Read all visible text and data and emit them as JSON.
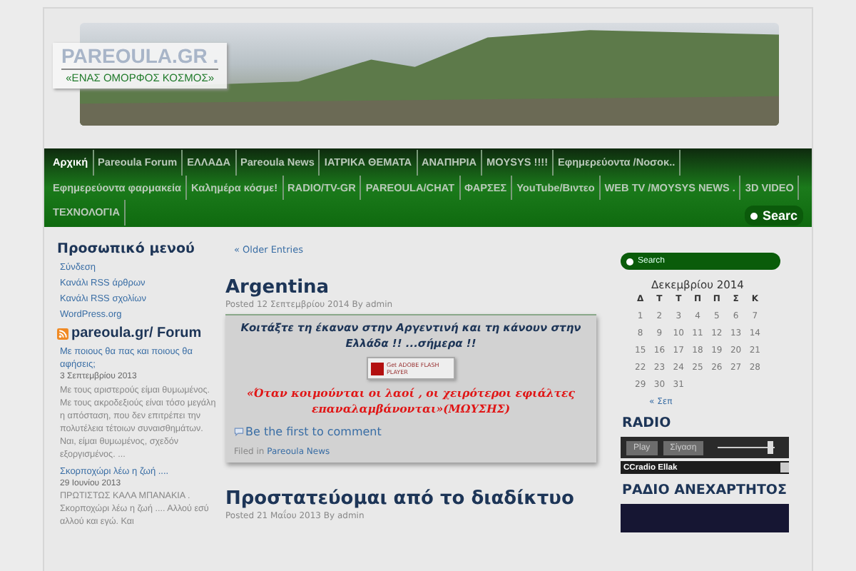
{
  "header": {
    "site_title": "PAREOULA.GR .",
    "tagline": "«ΕΝΑΣ ΟΜΟΡΦΟΣ ΚΟΣΜΟΣ»"
  },
  "nav": {
    "items": [
      {
        "label": "Αρχική",
        "selected": true
      },
      {
        "label": "Pareoula Forum",
        "selected": false
      },
      {
        "label": "ΕΛΛΑΔΑ",
        "selected": false
      },
      {
        "label": "Pareoula News",
        "selected": false
      },
      {
        "label": "ΙΑΤΡΙΚΑ ΘΕΜΑΤΑ",
        "selected": false
      },
      {
        "label": "ΑΝΑΠΗΡΙΑ",
        "selected": false
      },
      {
        "label": "MOYSYS !!!!",
        "selected": false
      },
      {
        "label": "Εφημερεύοντα /Νοσοκ..",
        "selected": false
      },
      {
        "label": "Εφημερεύοντα φαρμακεία",
        "selected": false
      },
      {
        "label": "Καλημέρα κόσμε!",
        "selected": false
      },
      {
        "label": "RADIO/TV-GR",
        "selected": false
      },
      {
        "label": "PAREOULA/CHAT",
        "selected": false
      },
      {
        "label": "ΦΑΡΣΕΣ",
        "selected": false
      },
      {
        "label": "YouTube/Βιντεο",
        "selected": false
      },
      {
        "label": "WEB TV /MOYSYS NEWS .",
        "selected": false
      },
      {
        "label": "3D VIDEO",
        "selected": false
      },
      {
        "label": "ΤΕΧΝΟΛΟΓΙΑ",
        "selected": false
      }
    ],
    "search_button": "Searc"
  },
  "left_sidebar": {
    "menu_title": "Προσωπικό μενού",
    "menu_links": [
      "Σύνδεση",
      "Κανάλι RSS άρθρων",
      "Κανάλι RSS σχολίων",
      "WordPress.org"
    ],
    "forum_title": "pareoula.gr/ Forum",
    "forum_posts": [
      {
        "title": "Με ποιους θα πας και ποιους θα αφήσεις;",
        "date": "3 Σεπτεμβρίου 2013",
        "excerpt": "Με τους αριστερούς είμαι θυμωμένος. Με τους ακροδεξιούς είναι τόσο μεγάλη η απόσταση, που δεν επιτρέπει την πολυτέλεια τέτοιων συναισθημάτων. Ναι, είμαι θυμωμένος, σχεδόν εξοργισμένος. ..."
      },
      {
        "title": "Σκορποχώρι λέω η ζωή ....",
        "date": "29 Ιουνίου 2013",
        "excerpt": "ΠΡΩΤΙΣΤΩΣ ΚΑΛΑ ΜΠΑΝΑΚΙΑ . Σκορποχώρι λέω η ζωή .... Αλλού εσύ αλλού και εγώ. Και"
      }
    ]
  },
  "main": {
    "older_entries": "« Older Entries",
    "posts": [
      {
        "title": "Argentina",
        "meta": "Posted 12 Σεπτεμβρίου 2014 By admin",
        "intro": "Κοιτάξτε τη έκαναν στην Αργεντινή και τη κάνουν στην Ελλάδα !! ...σήμερα !!",
        "flash_badge": "Get ADOBE FLASH PLAYER",
        "quote": "«Όταν κοιμούνται οι λαοί , οι χειρότεροι εφιάλτες επαναλαμβάνονται»(ΜΩΥΣΗΣ)",
        "comment_link": "Be the first to comment",
        "filed_label": "Filed in",
        "category": "Pareoula News"
      },
      {
        "title": "Προστατεύομαι από το διαδίκτυο",
        "meta": "Posted 21 Μαΐου 2013 By admin"
      }
    ]
  },
  "right_sidebar": {
    "search_placeholder": "Search",
    "calendar": {
      "title": "Δεκεμβρίου 2014",
      "weekdays": [
        "Δ",
        "Τ",
        "Τ",
        "Π",
        "Π",
        "Σ",
        "Κ"
      ],
      "weeks": [
        [
          "1",
          "2",
          "3",
          "4",
          "5",
          "6",
          "7"
        ],
        [
          "8",
          "9",
          "10",
          "11",
          "12",
          "13",
          "14"
        ],
        [
          "15",
          "16",
          "17",
          "18",
          "19",
          "20",
          "21"
        ],
        [
          "22",
          "23",
          "24",
          "25",
          "26",
          "27",
          "28"
        ],
        [
          "29",
          "30",
          "31"
        ]
      ],
      "prev_link": "« Σεπ"
    },
    "radio_title": "RADIO",
    "player": {
      "play": "Play",
      "mute": "Σίγαση",
      "level": 0.95,
      "station": "CCradio Ellak"
    },
    "radio2_title": "ΡΑΔΙΟ ΑΝΕΧΑΡΤΗΤΟΣ"
  }
}
